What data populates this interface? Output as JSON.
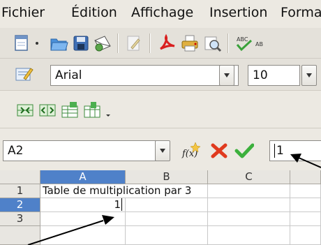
{
  "menu": {
    "items": [
      "Fichier",
      "Édition",
      "Affichage",
      "Insertion",
      "Forma"
    ]
  },
  "format_toolbar": {
    "font_name": "Arial",
    "font_size": "10"
  },
  "formula_bar": {
    "name_box": "A2",
    "input_value": "1"
  },
  "sheet": {
    "columns": [
      "A",
      "B",
      "C"
    ],
    "rows": [
      "1",
      "2",
      "3"
    ],
    "cells": {
      "A1": "Table de multiplication par 3",
      "A2": "1"
    },
    "active_cell": "A2"
  },
  "colors": {
    "selection_header": "#4f81c9",
    "grid_line": "#c8c8c8"
  },
  "icons": {
    "toolbar1": [
      "new-document-icon",
      "open-folder-icon",
      "save-icon",
      "email-icon",
      "edit-file-icon",
      "export-pdf-icon",
      "print-icon",
      "print-preview-icon",
      "spellcheck-icon"
    ],
    "toolbar3": [
      "merge-cells-icon",
      "split-cells-icon",
      "insert-rows-icon",
      "insert-columns-icon"
    ],
    "formula": [
      "function-wizard-icon",
      "cancel-icon",
      "accept-icon"
    ]
  }
}
